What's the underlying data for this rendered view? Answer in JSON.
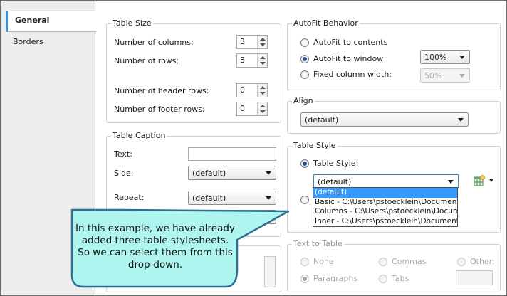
{
  "tabs": [
    {
      "label": "General",
      "active": true
    },
    {
      "label": "Borders",
      "active": false
    }
  ],
  "table_size": {
    "title": "Table Size",
    "columns_label": "Number of columns:",
    "columns_value": "3",
    "rows_label": "Number of rows:",
    "rows_value": "3",
    "header_rows_label": "Number of header rows:",
    "header_rows_value": "0",
    "footer_rows_label": "Number of footer rows:",
    "footer_rows_value": "0"
  },
  "autofit": {
    "title": "AutoFit Behavior",
    "contents_label": "AutoFit to contents",
    "window_label": "AutoFit to window",
    "window_value": "100%",
    "fixed_label": "Fixed column width:",
    "fixed_value": "50%",
    "selected": "window"
  },
  "align": {
    "title": "Align",
    "value": "(default)"
  },
  "caption": {
    "title": "Table Caption",
    "text_label": "Text:",
    "text_value": "",
    "side_label": "Side:",
    "side_value": "(default)",
    "repeat_label": "Repeat:",
    "repeat_value": "(default)"
  },
  "table_style": {
    "title": "Table Style",
    "radio_label": "Table Style:",
    "value": "(default)",
    "options": [
      "(default)",
      "Basic - C:\\Users\\pstoecklein\\Documents\\M",
      "Columns - C:\\Users\\pstoecklein\\Documents\\",
      "Inner - C:\\Users\\pstoecklein\\Documents\\M"
    ],
    "selected_index": 0,
    "icon": "table-style-icon"
  },
  "text_to_table": {
    "title": "Text to Table",
    "none_label": "None",
    "commas_label": "Commas",
    "other_label": "Other:",
    "paragraphs_label": "Paragraphs",
    "tabs_label": "Tabs",
    "selected": "paragraphs"
  },
  "callout": {
    "text": "In this example, we have already added three table stylesheets. So we can select them from this drop-down.",
    "fill": "#aef5f0",
    "border": "#2f6f93"
  }
}
